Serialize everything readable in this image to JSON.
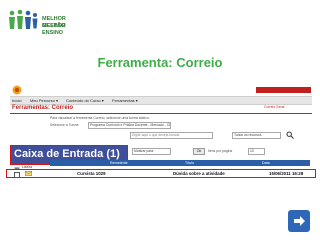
{
  "logo": {
    "line1": "MELHOR GESTÃO",
    "line2": "MELHOR ENSINO"
  },
  "title": "Ferramenta: Correio",
  "screen": {
    "menu": [
      "Início",
      "Meu Percurso ▾",
      "Conteúdo do Curso ▾",
      "Ferramentas ▾"
    ],
    "header_title": "Ferramentas: Correio",
    "intro_text": "Para visualizar a ferramenta Correio, selecione uma turma abaixo:",
    "turma_label": "Selecione a Turma:",
    "turma_value": "Programa Currículo e Prática Docente - Mercado - CP/1/1.",
    "right_link": "Correio Geral",
    "search_placeholder": "Digite aqui o que deseja buscar",
    "search_filter": "Todos os recursos",
    "folder_label": "Caixa de Entrada (1)",
    "show_label": "Mostrar para",
    "go_label": "Ok",
    "items_per_page_label": "Itens por página",
    "items_per_page_value": "10",
    "columns": [
      "Remetente",
      "Título",
      "Data"
    ],
    "rows": [
      {
        "sender": "Cursista 1029",
        "subject": "Dúvida sobre a atividade",
        "date": "15/06/2011 16:28"
      }
    ],
    "left_link": "Lixeira"
  },
  "colors": {
    "title_green": "#3fae49",
    "header_blue": "#2a5fa8",
    "highlight_red": "#dd1111",
    "callout_blue": "#3f4f9a",
    "next_blue": "#2f67b8"
  },
  "icons": [
    "logo-people-icon",
    "mail-icon",
    "trash-icon",
    "next-arrow-icon"
  ]
}
